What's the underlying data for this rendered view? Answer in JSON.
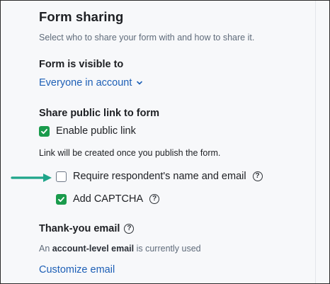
{
  "section": {
    "title": "Form sharing",
    "subtitle": "Select who to share your form with and how to share it."
  },
  "visibility": {
    "heading": "Form is visible to",
    "selected": "Everyone in account"
  },
  "public_link": {
    "heading": "Share public link to form",
    "enable_label": "Enable public link",
    "enable_checked": true,
    "note": "Link will be created once you publish the form.",
    "require_label": "Require respondent's name and email",
    "require_checked": false,
    "captcha_label": "Add CAPTCHA",
    "captcha_checked": true
  },
  "thankyou": {
    "heading": "Thank-you email",
    "status_prefix": "An",
    "status_bold": "account-level email",
    "status_suffix": "is currently used",
    "customize_label": "Customize email"
  },
  "icons": {
    "help": "question-circle-icon",
    "check": "check-icon",
    "chevron": "chevron-down-icon",
    "arrow": "arrow-right-icon"
  },
  "colors": {
    "accent_green": "#1a9b4c",
    "arrow_teal": "#1fa58a",
    "link_blue": "#1d5fb6"
  }
}
